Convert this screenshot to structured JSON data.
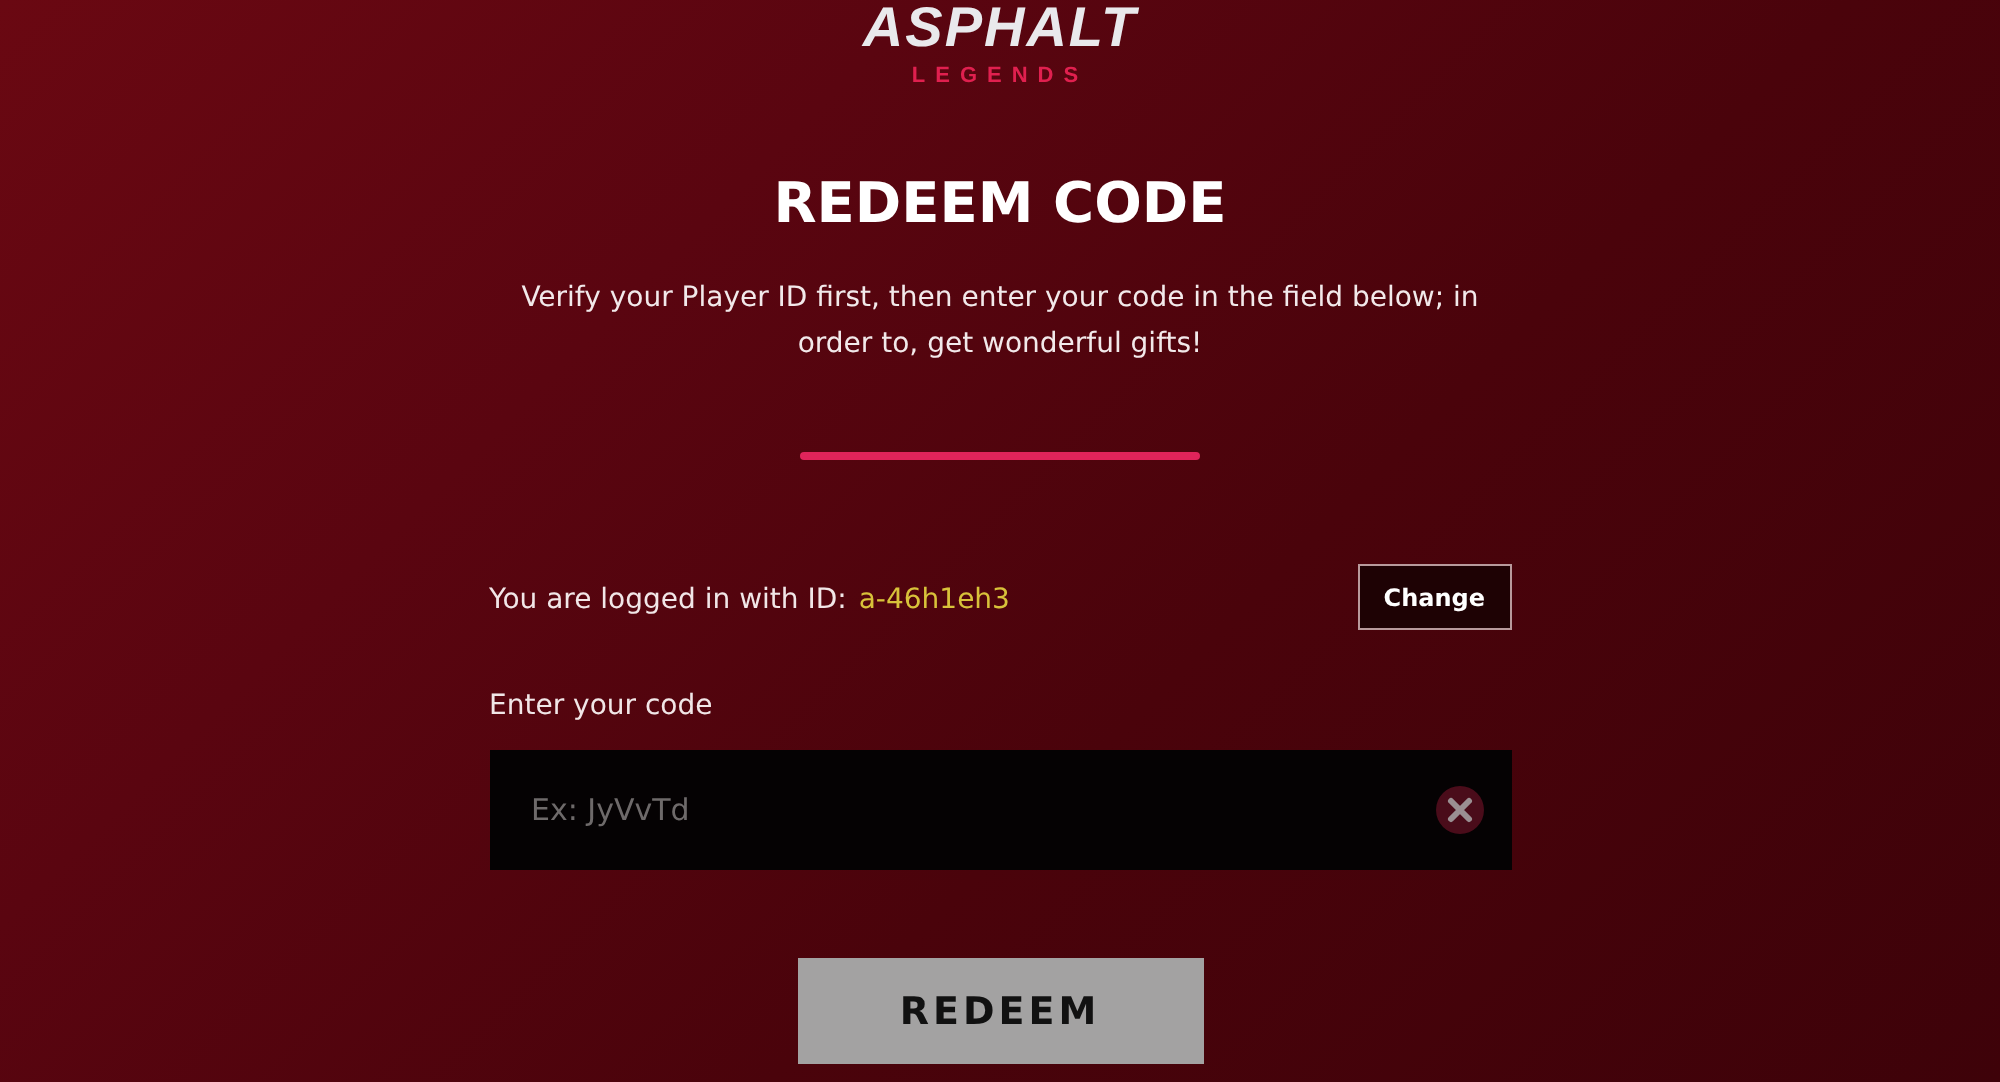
{
  "logo": {
    "title": "ASPHALT",
    "subtitle": "LEGENDS"
  },
  "heading": "REDEEM CODE",
  "description": "Verify your Player ID first, then enter your code in the field below; in order to, get wonderful gifts!",
  "login": {
    "text": "You are logged in with ID:",
    "player_id": "a-46h1eh3",
    "change_button": "Change"
  },
  "code_field": {
    "label": "Enter your code",
    "placeholder": "Ex: JyVvTd"
  },
  "redeem_button": {
    "label": "REDEEM",
    "disabled": true
  }
}
